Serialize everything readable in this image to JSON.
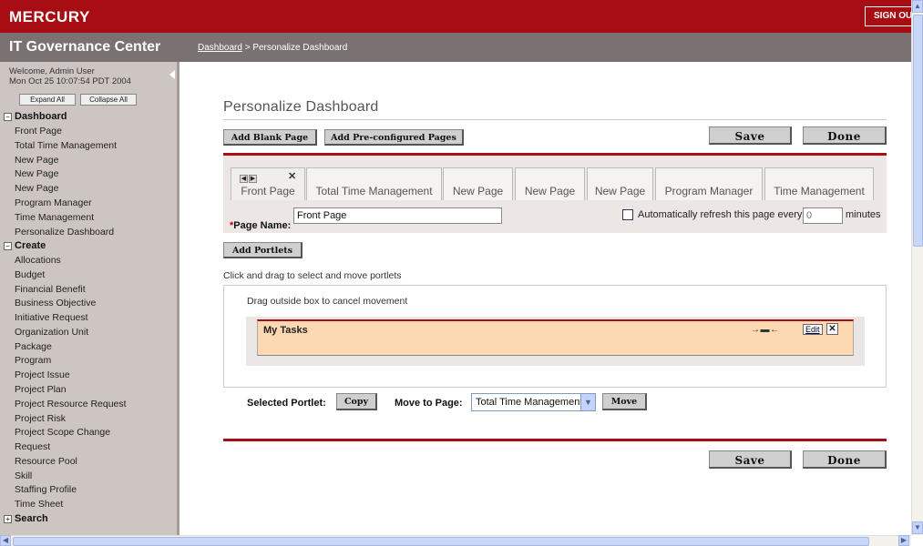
{
  "header": {
    "brand": "MERCURY",
    "signout": "SIGN OUT",
    "app_title": "IT Governance Center",
    "breadcrumb_link": "Dashboard",
    "breadcrumb_rest": " > Personalize Dashboard"
  },
  "sidebar": {
    "welcome_line1": "Welcome, Admin User",
    "welcome_line2": "Mon Oct 25 10:07:54 PDT 2004",
    "expand_all": "Expand All",
    "collapse_all": "Collapse All",
    "dashboard_section": "Dashboard",
    "dashboard_items": [
      "Front Page",
      "Total Time Management",
      "New Page",
      "New Page",
      "New Page",
      "Program Manager",
      "Time Management",
      "Personalize Dashboard"
    ],
    "create_section": "Create",
    "create_items": [
      "Allocations",
      "Budget",
      "Financial Benefit",
      "Business Objective",
      "Initiative Request",
      "Organization Unit",
      "Package",
      "Program",
      "Project Issue",
      "Project Plan",
      "Project Resource Request",
      "Project Risk",
      "Project Scope Change",
      "Request",
      "Resource Pool",
      "Skill",
      "Staffing Profile",
      "Time Sheet"
    ],
    "search_section": "Search"
  },
  "main": {
    "title": "Personalize Dashboard",
    "add_blank_page": "Add Blank Page",
    "add_preconfigured": "Add Pre-configured Pages",
    "save": "Save",
    "done": "Done",
    "tabs": [
      "Front Page",
      "Total Time Management",
      "New Page",
      "New Page",
      "New Page",
      "Program Manager",
      "Time Management"
    ],
    "page_name_required": "*",
    "page_name_label": "Page Name:",
    "page_name_value": "Front Page",
    "auto_refresh_label": "Automatically refresh this page every",
    "refresh_placeholder": "0",
    "minutes_label": "minutes",
    "add_portlets": "Add Portlets",
    "drag_hint": "Click and drag to select and move portlets",
    "cancel_hint": "Drag outside box to cancel movement",
    "portlet_title": "My Tasks",
    "portlet_edit": "Edit",
    "selected_portlet_label": "Selected Portlet:",
    "copy": "Copy",
    "move_to_page_label": "Move to Page:",
    "move_to_page_value": "Total Time Management",
    "move": "Move"
  }
}
